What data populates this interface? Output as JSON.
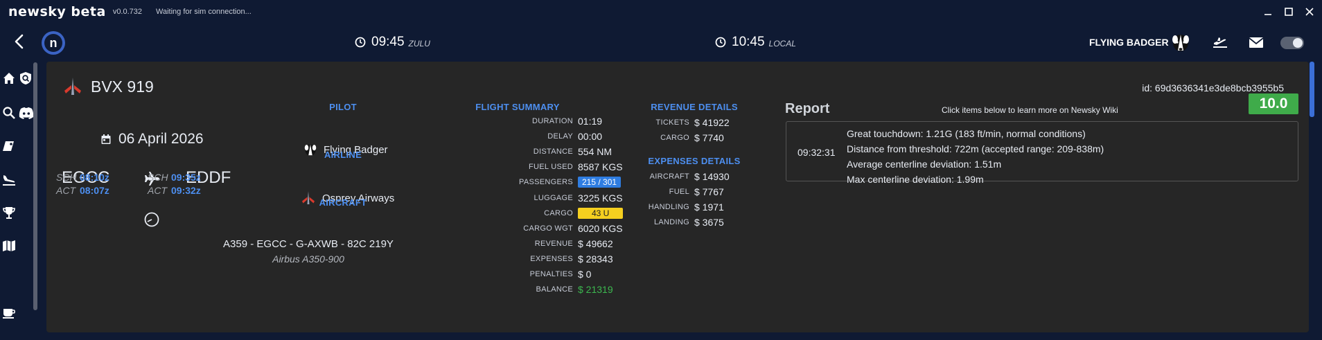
{
  "window": {
    "app_name": "newsky beta",
    "version": "v0.0.732",
    "status": "Waiting for sim connection..."
  },
  "header": {
    "zulu_time": "09:45",
    "zulu_label": "ZULU",
    "local_time": "10:45",
    "local_label": "LOCAL",
    "username": "FLYING BADGER"
  },
  "flight": {
    "callsign": "BVX 919",
    "id_text": "id: 69d3636341e3de8bcb3955b5",
    "date": "06 April 2026",
    "origin": "EGCC",
    "destination": "EDDF",
    "dep_sch_label": "SCH",
    "dep_sch": "08:10z",
    "dep_act_label": "ACT",
    "dep_act": "08:07z",
    "arr_sch_label": "SCH",
    "arr_sch": "09:35z",
    "arr_act_label": "ACT",
    "arr_act": "09:32z"
  },
  "info": {
    "pilot_heading": "PILOT",
    "pilot_name": "Flying Badger",
    "airline_heading": "AIRLINE",
    "airline_name": "Osprey Airways",
    "aircraft_heading": "AIRCRAFT",
    "aircraft_line": "A359 - EGCC - G-AXWB - 82C 219Y",
    "aircraft_type": "Airbus A350-900"
  },
  "summary": {
    "heading": "FLIGHT SUMMARY",
    "rows": [
      {
        "label": "DURATION",
        "value": "01:19"
      },
      {
        "label": "DELAY",
        "value": "00:00"
      },
      {
        "label": "DISTANCE",
        "value": "554 NM"
      },
      {
        "label": "FUEL USED",
        "value": "8587 KGS"
      },
      {
        "label": "PASSENGERS",
        "value": "215 / 301"
      },
      {
        "label": "LUGGAGE",
        "value": "3225 KGS"
      },
      {
        "label": "CARGO",
        "value": "43 U"
      },
      {
        "label": "CARGO WGT",
        "value": "6020 KGS"
      },
      {
        "label": "REVENUE",
        "value": "$ 49662"
      },
      {
        "label": "EXPENSES",
        "value": "$ 28343"
      },
      {
        "label": "PENALTIES",
        "value": "$ 0"
      },
      {
        "label": "BALANCE",
        "value": "$ 21319"
      }
    ]
  },
  "revenue": {
    "heading": "REVENUE DETAILS",
    "rows": [
      {
        "label": "TICKETS",
        "value": "$ 41922"
      },
      {
        "label": "CARGO",
        "value": "$ 7740"
      }
    ]
  },
  "expenses": {
    "heading": "EXPENSES DETAILS",
    "rows": [
      {
        "label": "AIRCRAFT",
        "value": "$ 14930"
      },
      {
        "label": "FUEL",
        "value": "$ 7767"
      },
      {
        "label": "HANDLING",
        "value": "$ 1971"
      },
      {
        "label": "LANDING",
        "value": "$ 3675"
      }
    ]
  },
  "report": {
    "title": "Report",
    "wiki_hint": "Click items below to learn more on Newsky Wiki",
    "score": "10.0",
    "entry_time": "09:32:31",
    "lines": [
      "Great touchdown: 1.21G (183 ft/min, normal conditions)",
      "Distance from threshold: 722m (accepted range: 209-838m)",
      "Average centerline deviation: 1.51m",
      "Max centerline deviation: 1.99m"
    ]
  },
  "colors": {
    "accent_blue": "#4d8ff0",
    "score_green": "#3fab4a",
    "balance_green": "#3cb84f",
    "cargo_yellow": "#f5cf1f"
  },
  "icons": [
    "back-icon",
    "app-logo",
    "clock-icon",
    "badger-avatar",
    "flights-icon",
    "mail-icon",
    "theme-toggle",
    "home-icon",
    "search-icon",
    "discord-icon",
    "tag-icon",
    "landing-icon",
    "trophy-icon",
    "map-icon",
    "coffee-icon",
    "calendar-icon",
    "plane-icon",
    "gauge-icon"
  ]
}
